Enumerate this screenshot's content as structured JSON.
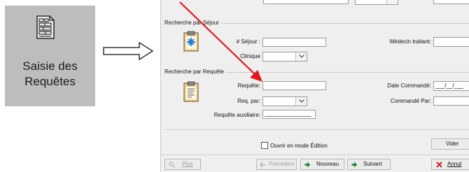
{
  "tile": {
    "icon": "document-form-icon",
    "label_line1": "Saisie des",
    "label_line2": "Requêtes"
  },
  "arrow_icon": "hollow-right-arrow-icon",
  "sections": {
    "sejour": {
      "title": "Recherche par Séjour",
      "icon": "medical-record-icon",
      "sejour_label": "# Séjour :",
      "sejour_value": "",
      "medecin_label": "Médecin traitant:",
      "medecin_value": "",
      "clinique_label": "Clinique",
      "clinique_value": ""
    },
    "requete": {
      "title": "Recherche par Requête",
      "icon": "document-icon",
      "requete_label": "Requête:",
      "requete_value": "",
      "date_label": "Date Commandé:",
      "date_value": "___/__/___",
      "reqpar_label": "Req. par:",
      "reqpar_value": "",
      "commande_label": "Commandé Par:",
      "commande_value": "",
      "aux_label": "Requête auxiliaire:",
      "aux_value": "_______________"
    }
  },
  "ouvrir_edition": {
    "label": "Ouvrir en mode Édition",
    "checked": false
  },
  "buttons": {
    "vider": "Vider",
    "plus": "Plus",
    "precedent": "Précédent",
    "nouveau": "Nouveau",
    "suivant": "Suivant",
    "annuler": "Annul"
  },
  "colors": {
    "annotation_arrow": "#e3161c",
    "nav_arrow": "#2e8b3e",
    "cancel_x": "#d42020"
  }
}
